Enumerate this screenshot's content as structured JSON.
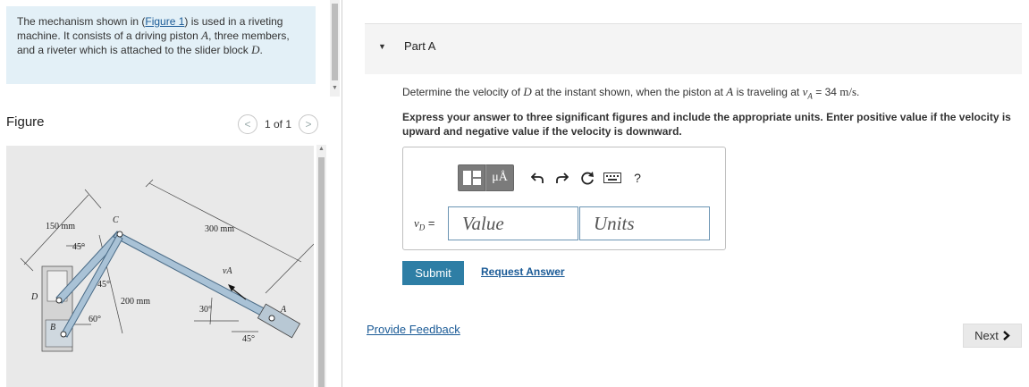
{
  "problem": {
    "text_1": "The mechanism shown in (",
    "figure_link": "Figure 1",
    "text_2": ") is used in a riveting machine. It consists of a driving piston ",
    "var_A": "A",
    "text_3": ", three members, and a riveter which is attached to the slider block ",
    "var_D": "D",
    "text_4": "."
  },
  "figure": {
    "title": "Figure",
    "pagination": "1 of 1",
    "labels": {
      "dim_150": "150 mm",
      "dim_300": "300 mm",
      "dim_200": "200 mm",
      "angle_45_top": "45°",
      "angle_45_mid": "45°",
      "angle_60": "60°",
      "angle_30": "30°",
      "angle_45_bottom": "45°",
      "point_C": "C",
      "point_D": "D",
      "point_B": "B",
      "point_A": "A",
      "vel_vA": "vA"
    }
  },
  "part": {
    "label": "Part A",
    "question_1": "Determine the velocity of ",
    "question_var_D": "D",
    "question_2": " at the instant shown, when the piston at ",
    "question_var_A": "A",
    "question_3": " is traveling at ",
    "question_vA": "v",
    "question_vA_sub": "A",
    "question_4": " = 34 ",
    "question_units": "m/s",
    "question_5": ".",
    "instructions": "Express your answer to three significant figures and include the appropriate units. Enter positive value if the velocity is upward and negative value if the velocity is downward."
  },
  "answer": {
    "var_label": "v",
    "var_sub": "D",
    "equals": " =",
    "value_placeholder": "Value",
    "units_placeholder": "Units",
    "units_button": "μÅ",
    "help_button": "?"
  },
  "actions": {
    "submit": "Submit",
    "request_answer": "Request Answer",
    "provide_feedback": "Provide Feedback",
    "next": "Next"
  },
  "icons": {
    "template": "template-icon",
    "units": "units-icon",
    "undo": "undo-icon",
    "redo": "redo-icon",
    "reset": "reset-icon",
    "keyboard": "keyboard-icon",
    "help": "help-icon",
    "collapse": "triangle-down-icon",
    "prev": "chevron-left-icon",
    "next": "chevron-right-icon"
  }
}
